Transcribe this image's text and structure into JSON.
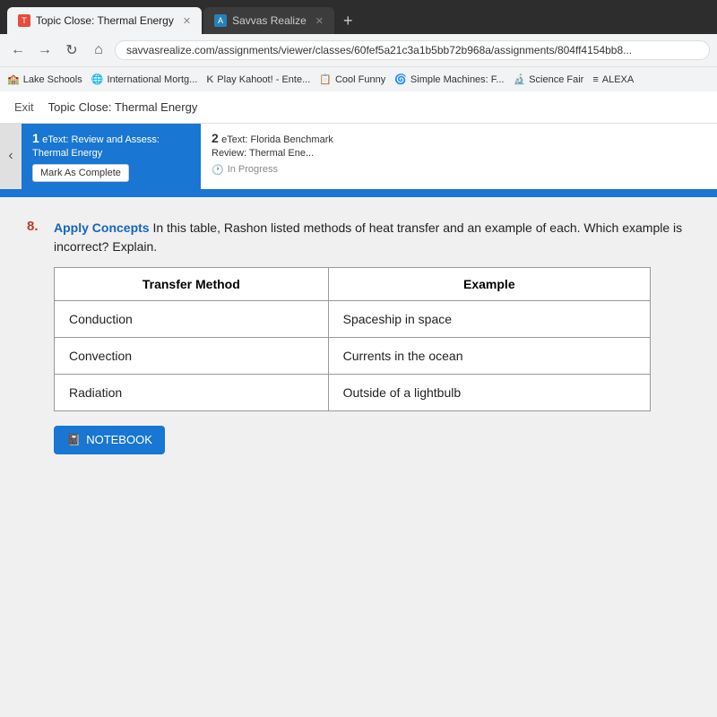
{
  "browser": {
    "tabs": [
      {
        "id": "tab1",
        "label": "Topic Close: Thermal Energy",
        "icon_color": "#e74c3c",
        "icon_letter": "T",
        "active": true
      },
      {
        "id": "tab2",
        "label": "Savvas Realize",
        "icon_color": "#2980b9",
        "icon_letter": "A",
        "active": false
      }
    ],
    "new_tab_label": "+",
    "address": "savvasrealize.com/assignments/viewer/classes/60fef5a21c3a1b5bb72b968a/assignments/804ff4154bb8...",
    "bookmarks": [
      {
        "label": "Lake Schools",
        "icon": "🏫"
      },
      {
        "label": "International Mortg...",
        "icon": "🌐"
      },
      {
        "label": "Play Kahoot! - Ente...",
        "icon": "K"
      },
      {
        "label": "Cool Funny",
        "icon": "📋"
      },
      {
        "label": "Simple Machines: F...",
        "icon": "🌀"
      },
      {
        "label": "Science Fair",
        "icon": "🔬"
      },
      {
        "label": "ALEXA",
        "icon": "≡"
      }
    ]
  },
  "page": {
    "exit_label": "Exit",
    "topic_title": "Topic Close: Thermal Energy",
    "assignment_tabs": [
      {
        "number": "1",
        "title": "eText: Review and Assess: Thermal Energy",
        "active": true,
        "mark_complete_label": "Mark As Complete"
      },
      {
        "number": "2",
        "title": "eText: Florida Benchmark Review: Thermal Ene...",
        "active": false,
        "status_label": "In Progress"
      }
    ]
  },
  "question": {
    "number": "8.",
    "highlight": "Apply Concepts",
    "text": "In this table, Rashon listed methods of heat transfer and an example of each. Which example is incorrect? Explain.",
    "table": {
      "headers": [
        "Transfer Method",
        "Example"
      ],
      "rows": [
        [
          "Conduction",
          "Spaceship in space"
        ],
        [
          "Convection",
          "Currents in the ocean"
        ],
        [
          "Radiation",
          "Outside of a lightbulb"
        ]
      ]
    },
    "notebook_button_label": "NOTEBOOK"
  }
}
